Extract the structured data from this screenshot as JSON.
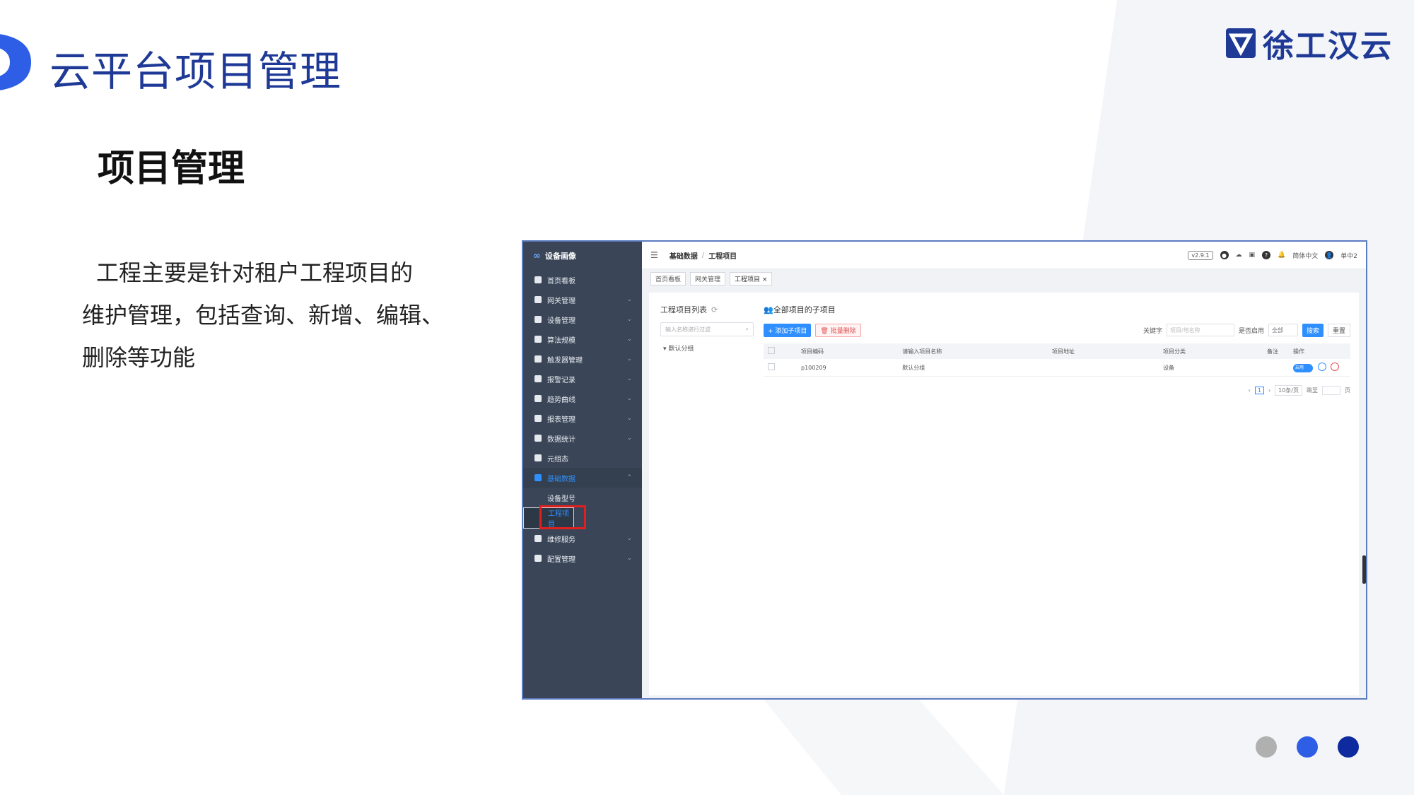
{
  "slide": {
    "title": "云平台项目管理",
    "subtitle": "项目管理",
    "description_lines": [
      "工程主要是针对租户工程项目的",
      "维护管理，包括查询、新增、编辑、",
      "删除等功能"
    ],
    "brand": "徐工汉云",
    "accent_color": "#1f3a96",
    "pager_dots": [
      "#b0b0b0",
      "#2f5ee6",
      "#0d2a9e"
    ]
  },
  "app": {
    "logo_text": "设备画像",
    "sidebar": [
      {
        "label": "首页看板",
        "icon": "dashboard-icon"
      },
      {
        "label": "网关管理",
        "icon": "gateway-icon",
        "chevron": "⌄"
      },
      {
        "label": "设备管理",
        "icon": "device-icon",
        "chevron": "⌄"
      },
      {
        "label": "算法规模",
        "icon": "gear-icon",
        "chevron": "⌄"
      },
      {
        "label": "触发器管理",
        "icon": "trigger-icon",
        "chevron": "⌄"
      },
      {
        "label": "报警记录",
        "icon": "alarm-icon",
        "chevron": "⌄"
      },
      {
        "label": "趋势曲线",
        "icon": "chart-icon",
        "chevron": "⌄"
      },
      {
        "label": "报表管理",
        "icon": "report-icon",
        "chevron": "⌄"
      },
      {
        "label": "数据统计",
        "icon": "stats-icon",
        "chevron": "⌄"
      },
      {
        "label": "元组态",
        "icon": "user-icon"
      },
      {
        "label": "基础数据",
        "icon": "data-icon",
        "chevron": "⌃"
      },
      {
        "label": "维修服务",
        "icon": "tools-icon",
        "chevron": "⌄"
      },
      {
        "label": "配置管理",
        "icon": "config-icon",
        "chevron": "⌄"
      }
    ],
    "sidebar_sub": [
      "设备型号",
      "工程项目"
    ],
    "breadcrumb": [
      "基础数据",
      "/",
      "工程项目"
    ],
    "version": "v2.9.1",
    "language": "简体中文",
    "username": "单中2",
    "tabs": [
      "首页看板",
      "网关管理",
      "工程项目 ×"
    ],
    "left_title": "工程项目列表",
    "left_search_placeholder": "输入名称进行过滤",
    "tree_root": "▾  默认分组",
    "right_title": "全部项目的子项目",
    "add_btn": "+ 添加子项目",
    "batch_delete_btn": "批量删除",
    "keyword_label": "关键字",
    "keyword_placeholder": "项目/地名称",
    "enabled_label": "是否启用",
    "enabled_value": "全部",
    "search_btn": "搜索",
    "reset_btn": "重置",
    "columns": [
      "项目编码",
      "请输入项目名称",
      "项目地址",
      "项目分类",
      "备注",
      "操作"
    ],
    "rows": [
      {
        "code": "p100209",
        "name": "默认分组",
        "address": "",
        "category": "设备",
        "remark": "",
        "toggle": "启用"
      }
    ],
    "pagination": {
      "page": "1",
      "per_page": "10条/页",
      "goto": "跳至",
      "page_unit": "页"
    }
  }
}
